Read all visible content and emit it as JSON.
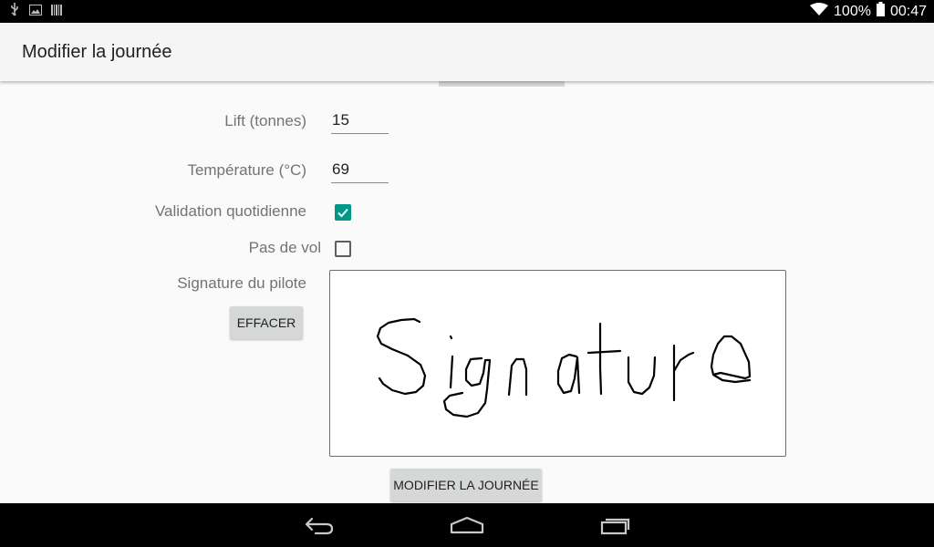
{
  "status_bar": {
    "battery": "100%",
    "time": "00:47",
    "icons": [
      "usb-icon",
      "image-icon",
      "barcode-icon",
      "wifi-icon",
      "battery-icon"
    ]
  },
  "action_bar": {
    "title": "Modifier la journée"
  },
  "form": {
    "lift_label": "Lift (tonnes)",
    "lift_value": "15",
    "temp_label": "Température (°C)",
    "temp_value": "69",
    "validation_label": "Validation quotidienne",
    "validation_checked": true,
    "pas_de_vol_label": "Pas de vol",
    "pas_de_vol_checked": false,
    "signature_label": "Signature du pilote",
    "effacer_label": "EFFACER",
    "submit_label": "MODIFIER LA JOURNÉE"
  },
  "colors": {
    "accent": "#009688",
    "button_bg": "#d6d7d7",
    "action_bar_bg": "#f5f5f5"
  },
  "nav_bar": {
    "icons": [
      "back-icon",
      "home-icon",
      "recents-icon"
    ]
  }
}
